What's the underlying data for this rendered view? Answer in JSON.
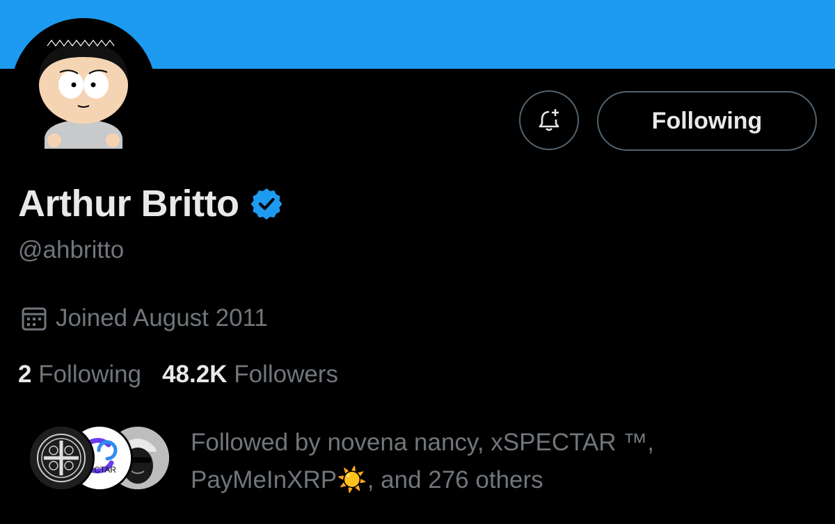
{
  "colors": {
    "banner": "#1d9bf0",
    "verified": "#1d9bf0",
    "background": "#000000",
    "primary_text": "#e7e9ea",
    "secondary_text": "#71767b",
    "border": "#536471"
  },
  "header": {
    "banner_icon": "banner-image",
    "avatar_icon": "cartoon-avatar"
  },
  "actions": {
    "notify_icon": "bell-plus-icon",
    "follow_label": "Following"
  },
  "profile": {
    "name": "Arthur Britto",
    "verified_icon": "verified-badge-icon",
    "handle": "@ahbritto",
    "joined_icon": "calendar-icon",
    "joined": "Joined August 2011"
  },
  "stats": {
    "following_count": "2",
    "following_label": "Following",
    "followers_count": "48.2K",
    "followers_label": "Followers"
  },
  "followed_by": {
    "avatars": [
      "medal-avatar",
      "xspectar-logo-avatar",
      "hooded-figure-avatar"
    ],
    "line1": "Followed by novena nancy, xSPECTAR ™,",
    "line2_name": "PayMeInXRP",
    "line2_emoji": "☀️",
    "line2_rest": ", and 276 others",
    "xspectar_logo_text": "PECTAR"
  }
}
